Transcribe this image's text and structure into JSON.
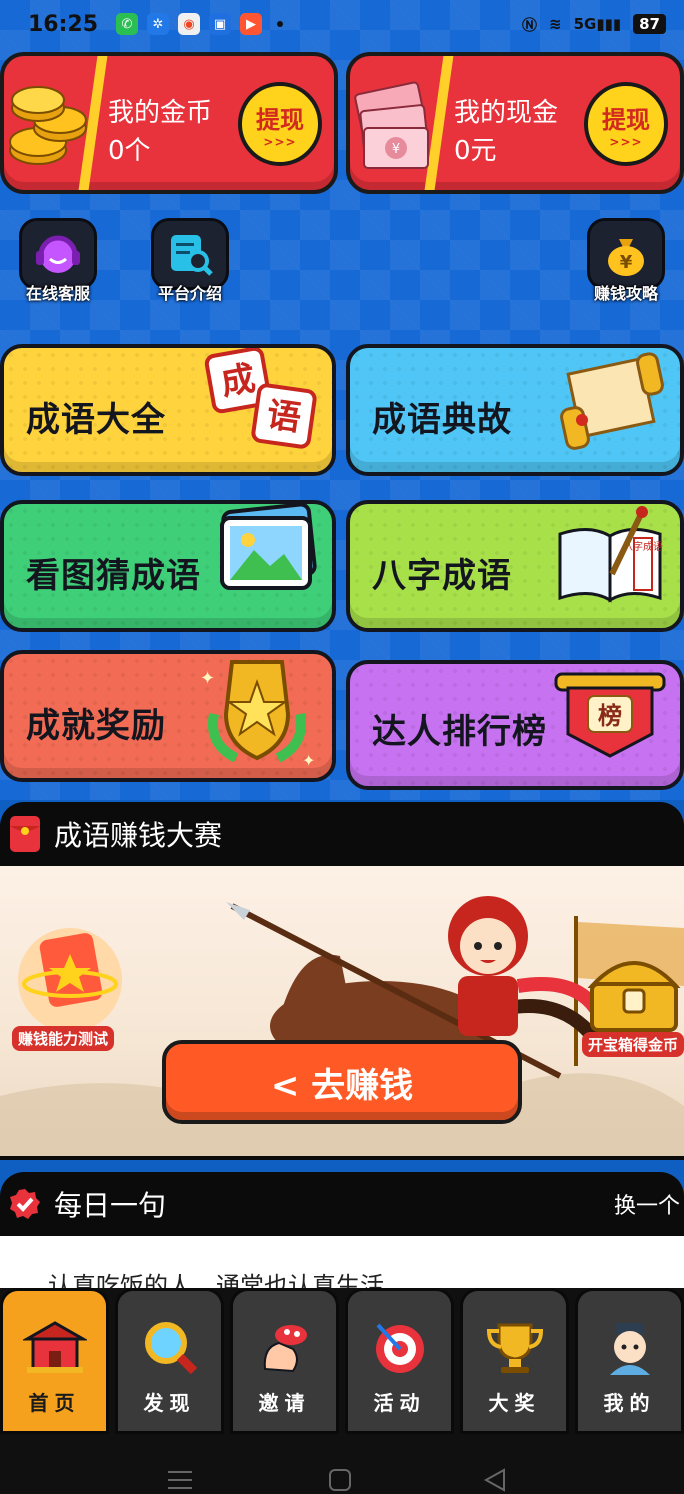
{
  "status": {
    "time": "16:25",
    "battery": "87",
    "network": "5G"
  },
  "money": {
    "coins_label": "我的金币",
    "coins_value": "0个",
    "cash_label": "我的现金",
    "cash_value": "0元",
    "withdraw_label": "提现",
    "withdraw_arrows": ">>>",
    "cash_symbol": "¥"
  },
  "quick": {
    "service": "在线客服",
    "intro": "平台介绍",
    "strategy": "赚钱攻略",
    "strategy_symbol": "¥"
  },
  "tiles": {
    "idioms": "成语大全",
    "idioms_chars": [
      "成",
      "语"
    ],
    "allusions": "成语典故",
    "guess": "看图猜成语",
    "eight": "八字成语",
    "eight_book": "八字成语",
    "achieve": "成就奖励",
    "rank": "达人排行榜",
    "rank_badge": "榜"
  },
  "contest": {
    "title": "成语赚钱大赛",
    "test_tag": "赚钱能力测试",
    "chest_tag": "开宝箱得金币",
    "go_button": "< 去赚钱"
  },
  "daily": {
    "title": "每日一句",
    "refresh": "换一个",
    "quote": "认真吃饭的人，通常也认真生活"
  },
  "nav": {
    "home": "首页",
    "discover": "发现",
    "invite": "邀请",
    "activity": "活动",
    "prize": "大奖",
    "mine": "我的"
  },
  "colors": {
    "bg_blue": "#1769d6",
    "card_red": "#e8323c",
    "accent_yellow": "#ffd21c",
    "go_orange": "#ff5a26",
    "nav_active": "#f5a11d"
  }
}
